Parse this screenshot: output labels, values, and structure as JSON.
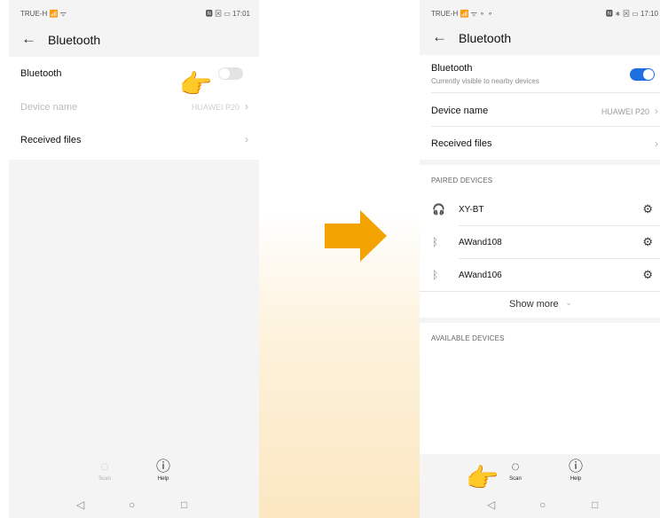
{
  "left": {
    "status": {
      "carrier": "TRUE-H  📶 ᯤ",
      "right": "🅽 ⊠ ▭ 17:01"
    },
    "header": {
      "back": "←",
      "title": "Bluetooth"
    },
    "rows": {
      "bluetooth_label": "Bluetooth",
      "device_name_label": "Device name",
      "device_name_value": "HUAWEI P20",
      "received_files_label": "Received files",
      "chevron": "›"
    },
    "bluetooth_enabled": false,
    "bottom": {
      "scan_label": "Scan",
      "help_label": "Help"
    }
  },
  "right": {
    "status": {
      "carrier": "TRUE-H  📶 ᯤ ⚬ ⚬",
      "right": "🅽 ∗ ⊠ ▭ 17:10"
    },
    "header": {
      "back": "←",
      "title": "Bluetooth"
    },
    "rows": {
      "bluetooth_label": "Bluetooth",
      "bluetooth_sub": "Currently visible to nearby devices",
      "device_name_label": "Device name",
      "device_name_value": "HUAWEI P20",
      "received_files_label": "Received files",
      "chevron": "›"
    },
    "bluetooth_enabled": true,
    "paired_header": "PAIRED DEVICES",
    "paired_devices": [
      {
        "name": "XY-BT",
        "icon": "headphones-icon"
      },
      {
        "name": "AWand108",
        "icon": "bluetooth-icon"
      },
      {
        "name": "AWand106",
        "icon": "bluetooth-icon"
      }
    ],
    "show_more": "Show more",
    "available_header": "AVAILABLE DEVICES",
    "bottom": {
      "scan_label": "Scan",
      "help_label": "Help"
    }
  },
  "colors": {
    "accent": "#1f6fe0",
    "arrow": "#f2a300",
    "hand": "#f7c23a"
  }
}
